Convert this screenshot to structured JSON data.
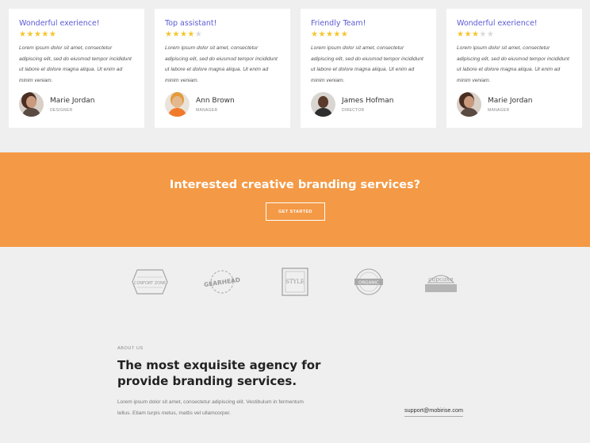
{
  "testimonials": [
    {
      "title": "Wonderful exerience!",
      "rating": 5,
      "text": "Lorem ipsum dolor sit amet, consectetur adipiscing elit, sed do eiusmod tempor incididunt ut labore et dolore magna aliqua. Ut enim ad minim veniam.",
      "name": "Marie Jordan",
      "role": "DESIGNER"
    },
    {
      "title": "Top assistant!",
      "rating": 4,
      "text": "Lorem ipsum dolor sit amet, consectetur adipiscing elit, sed do eiusmod tempor incididunt ut labore et dolore magna aliqua. Ut enim ad minim veniam.",
      "name": "Ann Brown",
      "role": "MANAGER"
    },
    {
      "title": "Friendly Team!",
      "rating": 5,
      "text": "Lorem ipsum dolor sit amet, consectetur adipiscing elit, sed do eiusmod tempor incididunt ut labore et dolore magna aliqua. Ut enim ad minim veniam.",
      "name": "James Hofman",
      "role": "DIRECTOR"
    },
    {
      "title": "Wonderful exerience!",
      "rating": 3,
      "text": "Lorem ipsum dolor sit amet, consectetur adipiscing elit, sed do eiusmod tempor incididunt ut labore et dolore magna aliqua. Ut enim ad minim veniam.",
      "name": "Marie Jordan",
      "role": "MANAGER"
    }
  ],
  "star_colors": {
    "on": "#f6c52a",
    "off": "#d9d9d9"
  },
  "cta": {
    "title": "Interested creative branding services?",
    "button_label": "GET STARTED",
    "background": "#f49945"
  },
  "logos": [
    {
      "name": "confort-zone-logo",
      "label": "CONFORT ZONE"
    },
    {
      "name": "gearhead-logo",
      "label": "GEARHEAD"
    },
    {
      "name": "style-logo",
      "label": "STYLE"
    },
    {
      "name": "organic-logo",
      "label": "ORGANIC"
    },
    {
      "name": "cupcake-logo",
      "label": "cupcake"
    }
  ],
  "about": {
    "kicker": "ABOUT US",
    "heading": "The most exquisite agency for provide branding services.",
    "text": "Lorem ipsum dolor sit amet, consectetur adipiscing elit. Vestibulum in fermentum tellus. Etiam turpis metus, mattis vel ullamcorper.",
    "email": "support@mobirise.com"
  }
}
